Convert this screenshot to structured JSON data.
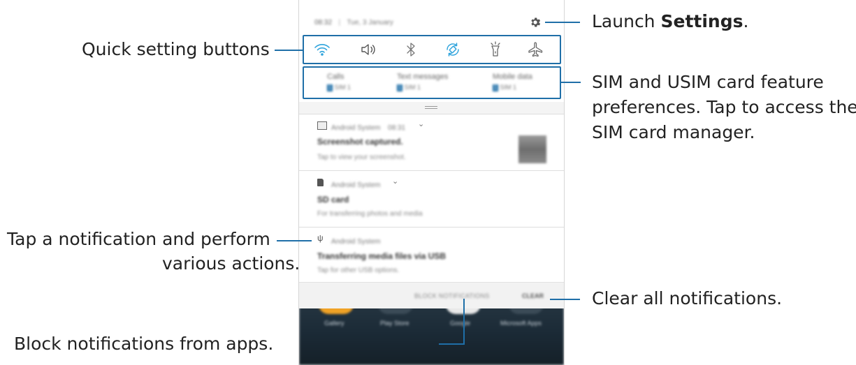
{
  "status_bar": {
    "time": "08:32",
    "date": "Tue, 3 January"
  },
  "quick_settings": {
    "buttons": [
      {
        "icon": "wifi-icon",
        "active": true
      },
      {
        "icon": "sound-icon",
        "active": false
      },
      {
        "icon": "bluetooth-icon",
        "active": false
      },
      {
        "icon": "auto-rotate-icon",
        "active": true
      },
      {
        "icon": "flashlight-icon",
        "active": false
      },
      {
        "icon": "airplane-mode-icon",
        "active": false
      }
    ],
    "accent_color": "#2ea3dc"
  },
  "sim": {
    "items": [
      {
        "label": "Calls",
        "badge": "1",
        "value": "SIM 1"
      },
      {
        "label": "Text messages",
        "badge": "1",
        "value": "SIM 1"
      },
      {
        "label": "Mobile data",
        "badge": "1",
        "value": "SIM 1"
      }
    ]
  },
  "notifications": [
    {
      "icon": "image-icon",
      "app": "Android System",
      "time": "08:31",
      "title": "Screenshot captured.",
      "text": "Tap to view your screenshot."
    },
    {
      "icon": "sd-card-icon",
      "app": "Android System",
      "time": "",
      "title": "SD card",
      "text": "For transferring photos and media"
    },
    {
      "icon": "usb-icon",
      "app": "Android System",
      "time": "",
      "title": "Transferring media files via USB",
      "text": "Tap for other USB options."
    }
  ],
  "footer": {
    "block_label": "BLOCK NOTIFICATIONS",
    "clear_label": "CLEAR"
  },
  "home_apps": [
    "Gallery",
    "Play Store",
    "Google",
    "Microsoft Apps"
  ],
  "callouts": {
    "settings_prefix": "Launch ",
    "settings_bold": "Settings",
    "settings_suffix": ".",
    "quick": "Quick setting buttons",
    "sim_line1": "SIM and USIM card feature",
    "sim_line2": "preferences. Tap to access the",
    "sim_line3": "SIM card manager.",
    "notif_line1": "Tap a notification and perform",
    "notif_line2": "various actions.",
    "clear": "Clear all notifications.",
    "block": "Block notifications from apps."
  },
  "colors": {
    "callout": "#1f6fa8",
    "home_dark": "#1b2a36",
    "app_orange": "#f0a226"
  }
}
